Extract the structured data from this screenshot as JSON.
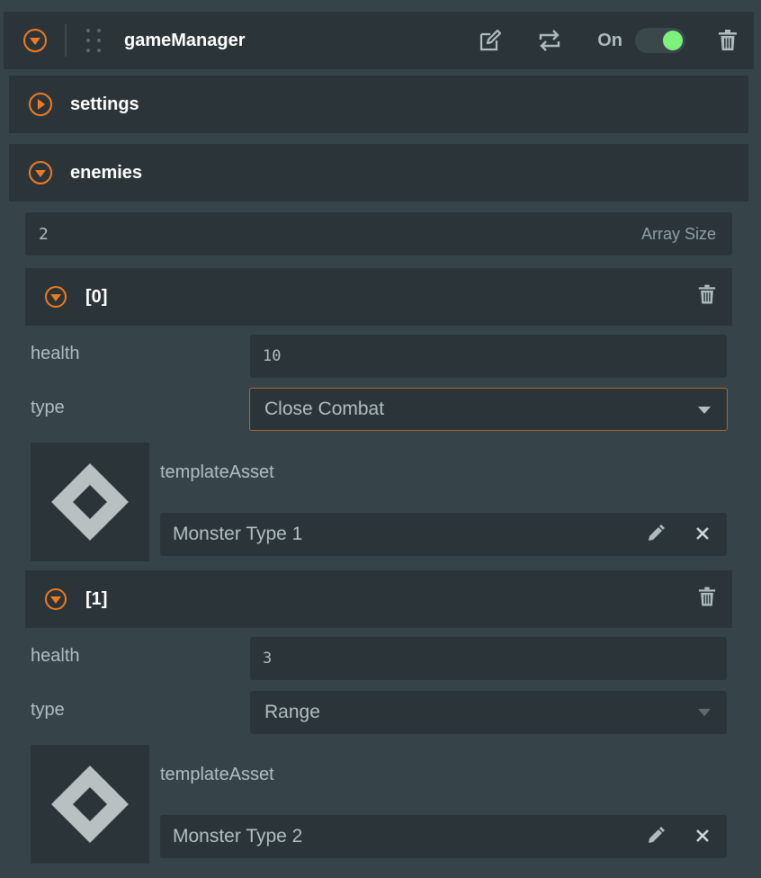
{
  "header": {
    "title": "gameManager",
    "toggle_label": "On",
    "toggle_state": "on",
    "accent_color": "#f07a1e",
    "toggle_color": "#7cf27c"
  },
  "sections": [
    {
      "label": "settings",
      "state": "collapsed"
    },
    {
      "label": "enemies",
      "state": "expanded"
    }
  ],
  "array": {
    "size": "2",
    "hint": "Array Size"
  },
  "items": [
    {
      "label": "[0]",
      "health_label": "health",
      "health": "10",
      "type_label": "type",
      "type": "Close Combat",
      "asset_label": "templateAsset",
      "asset": "Monster Type 1"
    },
    {
      "label": "[1]",
      "health_label": "health",
      "health": "3",
      "type_label": "type",
      "type": "Range",
      "asset_label": "templateAsset",
      "asset": "Monster Type 2"
    }
  ],
  "icons": {
    "collapse": "chevron-down-circle-icon",
    "expand": "chevron-right-circle-icon",
    "edit": "edit-icon",
    "refresh": "swap-icon",
    "delete": "trash-icon",
    "pencil": "pencil-icon",
    "clear": "close-icon",
    "asset": "diamond-icon"
  }
}
